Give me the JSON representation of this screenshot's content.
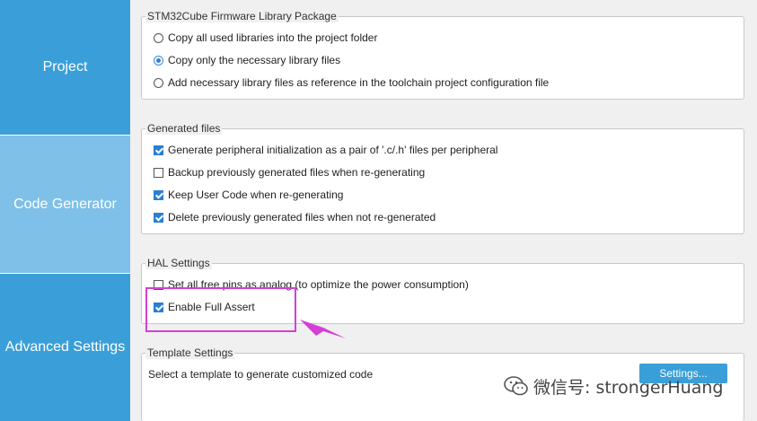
{
  "sidebar": {
    "tabs": [
      {
        "label": "Project"
      },
      {
        "label": "Code Generator"
      },
      {
        "label": "Advanced Settings"
      }
    ]
  },
  "firmware": {
    "title": "STM32Cube Firmware Library Package",
    "options": [
      {
        "label": "Copy all used libraries into the project folder",
        "selected": false
      },
      {
        "label": "Copy only the necessary library files",
        "selected": true
      },
      {
        "label": "Add necessary library files as reference in the toolchain project configuration file",
        "selected": false
      }
    ]
  },
  "generated": {
    "title": "Generated files",
    "options": [
      {
        "label": "Generate peripheral initialization as a pair of '.c/.h' files per peripheral",
        "checked": true
      },
      {
        "label": "Backup previously generated files when re-generating",
        "checked": false
      },
      {
        "label": "Keep User Code when re-generating",
        "checked": true
      },
      {
        "label": "Delete previously generated files when not re-generated",
        "checked": true
      }
    ]
  },
  "hal": {
    "title": "HAL Settings",
    "options": [
      {
        "label": "Set all free pins as analog (to optimize the power consumption)",
        "checked": false
      },
      {
        "label": "Enable Full Assert",
        "checked": true
      }
    ]
  },
  "template": {
    "title": "Template Settings",
    "description": "Select a template to generate customized code",
    "button_label": "Settings..."
  },
  "annotation": {
    "color": "#d53fd5"
  },
  "watermark": {
    "text": "微信号: strongerHuang",
    "icon": "wechat-icon"
  },
  "colors": {
    "accent": "#3a9fd8",
    "active_tab": "#7fc0e8",
    "check": "#2a7fd4"
  }
}
